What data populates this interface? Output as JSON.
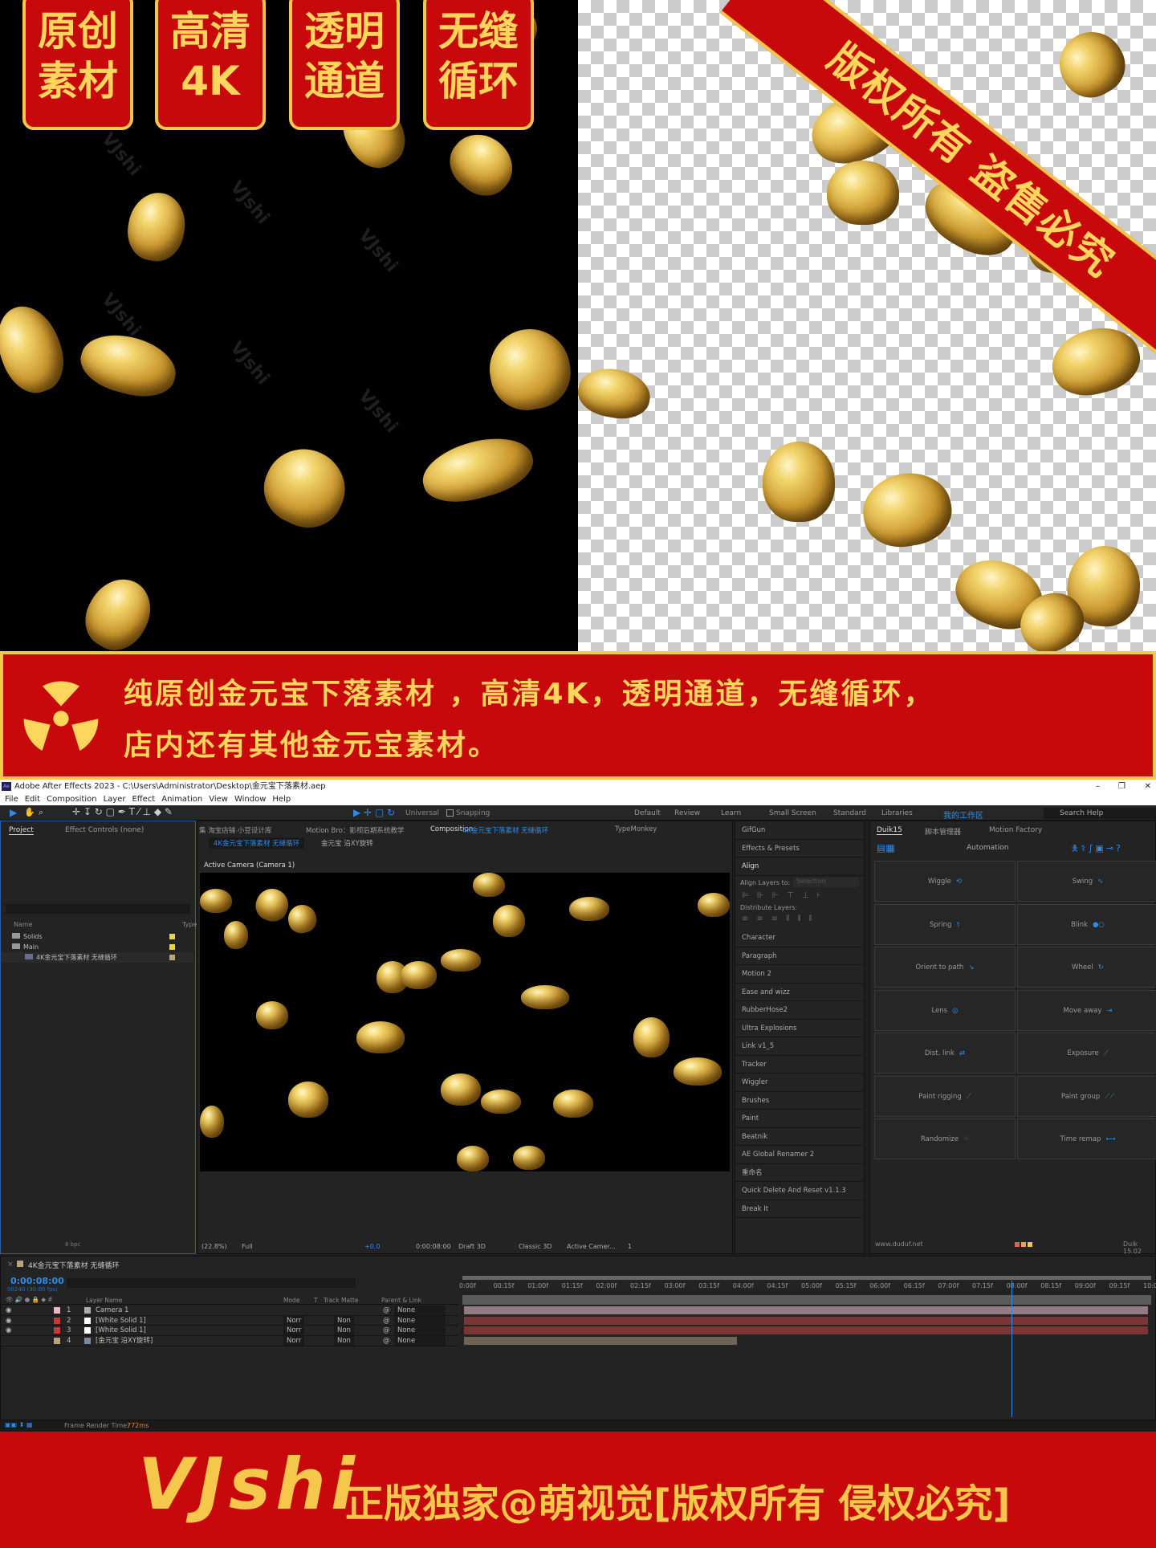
{
  "badges": [
    "原创\n素材",
    "高清\n4K",
    "透明\n通道",
    "无缝\n循环"
  ],
  "badge_lines": [
    [
      "原创",
      "素材"
    ],
    [
      "高清",
      "4K"
    ],
    [
      "透明",
      "通道"
    ],
    [
      "无缝",
      "循环"
    ]
  ],
  "ribbon": "版权所有 盗售必究",
  "watermark": "VJshi",
  "mid_banner": {
    "icon": "radiation-icon",
    "line1": "纯原创金元宝下落素材 ，高清4K，透明通道，无缝循环，",
    "line2": "店内还有其他金元宝素材。"
  },
  "colors": {
    "red": "#c8090b",
    "gold": "#f5c74a",
    "ae_blue": "#2d8ceb"
  },
  "ae": {
    "title": "Adobe After Effects 2023 - C:\\Users\\Administrator\\Desktop\\金元宝下落素材.aep",
    "menu": [
      "File",
      "Edit",
      "Composition",
      "Layer",
      "Effect",
      "Animation",
      "View",
      "Window",
      "Help"
    ],
    "toolbar": {
      "universal": "Universal",
      "snapping": "Snapping"
    },
    "workspaces": [
      "Default",
      "Review",
      "Learn",
      "Small Screen",
      "Standard",
      "Libraries"
    ],
    "active_workspace": "我的工作区",
    "search_placeholder": "Search Help",
    "project": {
      "tab": "Project",
      "tab2": "Effect Controls (none)",
      "col_name": "Name",
      "col_type": "Type",
      "items": [
        {
          "name": "Solids",
          "color": "#e6d83a"
        },
        {
          "name": "Main",
          "color": "#e6d83a"
        },
        {
          "name": "4K金元宝下落素材 无缝循环",
          "color": "#b8a57e"
        }
      ],
      "bpc": "8 bpc"
    },
    "comp": {
      "tabs": [
        "集 淘宝店铺 小豆设计库",
        "Motion Bro：影视后期系统教学",
        "Composition",
        "4K金元宝下落素材 无缝循环",
        "TypeMonkey"
      ],
      "breadcrumb": [
        "4K金元宝下落素材 无缝循环",
        "金元宝 沿XY旋转"
      ],
      "camera_label": "Active Camera (Camera 1)",
      "zoom": "(22.8%)",
      "resolution": "Full",
      "exposure": "+0.0",
      "time": "0:00:08:00",
      "draft": "Draft 3D",
      "renderer": "Classic 3D",
      "view": "Active Camer...",
      "views": "1"
    },
    "side_panels": {
      "gifgun": "GifGun",
      "effects": "Effects & Presets",
      "align": "Align",
      "align_to_label": "Align Layers to:",
      "align_to_value": "Selection",
      "distribute": "Distribute Layers:",
      "items": [
        "Character",
        "Paragraph",
        "Motion 2",
        "Ease and wizz",
        "RubberHose2",
        "Ultra Explosions",
        "Link v1_5",
        "Tracker",
        "Wiggler",
        "Brushes",
        "Paint",
        "Beatnik",
        "AE Global Renamer 2",
        "重命名",
        "Quick Delete And Reset v1.1.3",
        "Break It"
      ]
    },
    "duik": {
      "tabs": [
        "Duik15",
        "脚本管理器",
        "Motion Factory"
      ],
      "section": "Automation",
      "buttons": [
        "Wiggle",
        "Swing",
        "Spring",
        "Blink",
        "Orient to path",
        "Wheel",
        "Lens",
        "Move away",
        "Dist. link",
        "Exposure",
        "Paint rigging",
        "Paint group",
        "Randomize",
        "Time remap"
      ],
      "footer_link": "www.duduf.net",
      "version": "Duik 15.02"
    },
    "timeline": {
      "comp_name": "4K金元宝下落素材 无缝循环",
      "timecode": "0:00:08:00",
      "frames": "00240 (30.00 fps)",
      "cols": {
        "layer_name": "Layer Name",
        "mode": "Mode",
        "t": "T",
        "track_matte": "Track Matte",
        "parent": "Parent & Link"
      },
      "ruler": [
        "0:00f",
        "00:15f",
        "01:00f",
        "01:15f",
        "02:00f",
        "02:15f",
        "03:00f",
        "03:15f",
        "04:00f",
        "04:15f",
        "05:00f",
        "05:15f",
        "06:00f",
        "06:15f",
        "07:00f",
        "07:15f",
        "08:00f",
        "08:15f",
        "09:00f",
        "09:15f",
        "10:00f"
      ],
      "current_time_seconds": 8,
      "duration_seconds": 10,
      "layers": [
        {
          "num": "1",
          "name": "Camera 1",
          "label": "#e8b8c8",
          "bar": "#917c84",
          "mode": "",
          "matte": "",
          "parent": "None"
        },
        {
          "num": "2",
          "name": "[White Solid 1]",
          "label": "#c83a3a",
          "bar": "#7a3535",
          "mode": "Norr",
          "matte": "Non",
          "parent": "None"
        },
        {
          "num": "3",
          "name": "[White Solid 1]",
          "label": "#c83a3a",
          "bar": "#7a3535",
          "mode": "Norr",
          "matte": "Non",
          "parent": "None"
        },
        {
          "num": "4",
          "name": "[金元宝 沿XY旋转]",
          "label": "#b8a57e",
          "bar": "#6e6455",
          "mode": "Norr",
          "matte": "Non",
          "parent": "None"
        }
      ],
      "render_label": "Frame Render Time:",
      "render_time": "772ms"
    }
  },
  "bottom_banner": {
    "brand": "VJshi",
    "text": "正版独家@萌视觉[版权所有 侵权必究]"
  }
}
